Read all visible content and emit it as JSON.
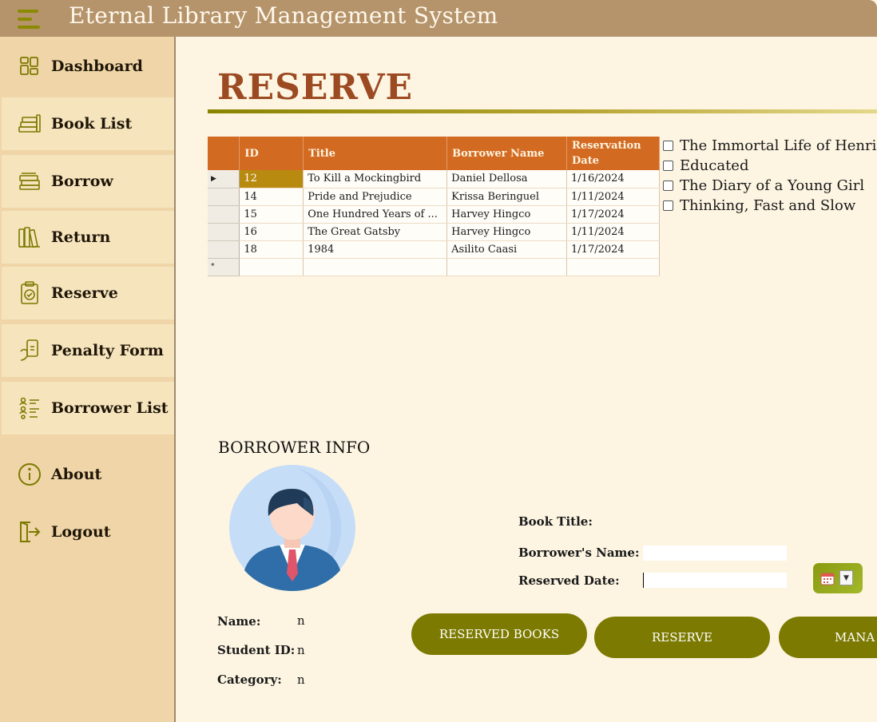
{
  "header": {
    "title": "Eternal Library Management System",
    "menu_icon": "hamburger-menu-icon"
  },
  "sidebar": {
    "items": [
      {
        "label": "Dashboard",
        "icon": "dashboard-grid-icon"
      },
      {
        "label": "Book List",
        "icon": "book-stack-icon"
      },
      {
        "label": "Borrow",
        "icon": "books-icon"
      },
      {
        "label": "Return",
        "icon": "bookshelf-icon"
      },
      {
        "label": "Reserve",
        "icon": "clipboard-check-icon"
      },
      {
        "label": "Penalty Form",
        "icon": "hand-phone-icon"
      },
      {
        "label": "Borrower List",
        "icon": "people-list-icon"
      },
      {
        "label": "About",
        "icon": "info-icon"
      },
      {
        "label": "Logout",
        "icon": "logout-icon"
      }
    ]
  },
  "page": {
    "title": "RESERVE"
  },
  "grid": {
    "columns": [
      "ID",
      "Title",
      "Borrower Name",
      "Reservation Date"
    ],
    "rows": [
      [
        "12",
        "To Kill a Mockingbird",
        "Daniel Dellosa",
        "1/16/2024"
      ],
      [
        "14",
        "Pride and Prejudice",
        "Krissa Beringuel",
        "1/11/2024"
      ],
      [
        "15",
        "One Hundred Years of ...",
        "Harvey Hingco",
        "1/17/2024"
      ],
      [
        "16",
        "The Great Gatsby",
        "Harvey Hingco",
        "1/11/2024"
      ],
      [
        "18",
        "1984",
        "Asilito Caasi",
        "1/17/2024"
      ]
    ],
    "new_row_marker": "*"
  },
  "books_checklist": [
    "The Immortal Life of Henriet",
    "Educated",
    "The Diary of a Young Girl",
    "Thinking, Fast and Slow"
  ],
  "borrower_info": {
    "section_title": "BORROWER INFO",
    "name_label": "Name:",
    "name_value": "n",
    "student_id_label": "Student ID:",
    "student_id_value": "n",
    "category_label": "Category:",
    "category_value": "n"
  },
  "form": {
    "book_title_label": "Book Title:",
    "borrower_name_label": "Borrower's Name:",
    "borrower_name_value": "",
    "reserved_date_label": "Reserved Date:",
    "reserved_date_value": "",
    "date_picker_icon": "calendar-icon"
  },
  "buttons": {
    "reserved_books": "RESERVED BOOKS",
    "reserve": "RESERVE",
    "manage": "MANA"
  },
  "colors": {
    "header_bg": "#b5946b",
    "sidebar_bg": "#efd5a7",
    "accent_orange": "#d26a22",
    "title_brown": "#9c4a22",
    "button_olive": "#7c7a00"
  }
}
